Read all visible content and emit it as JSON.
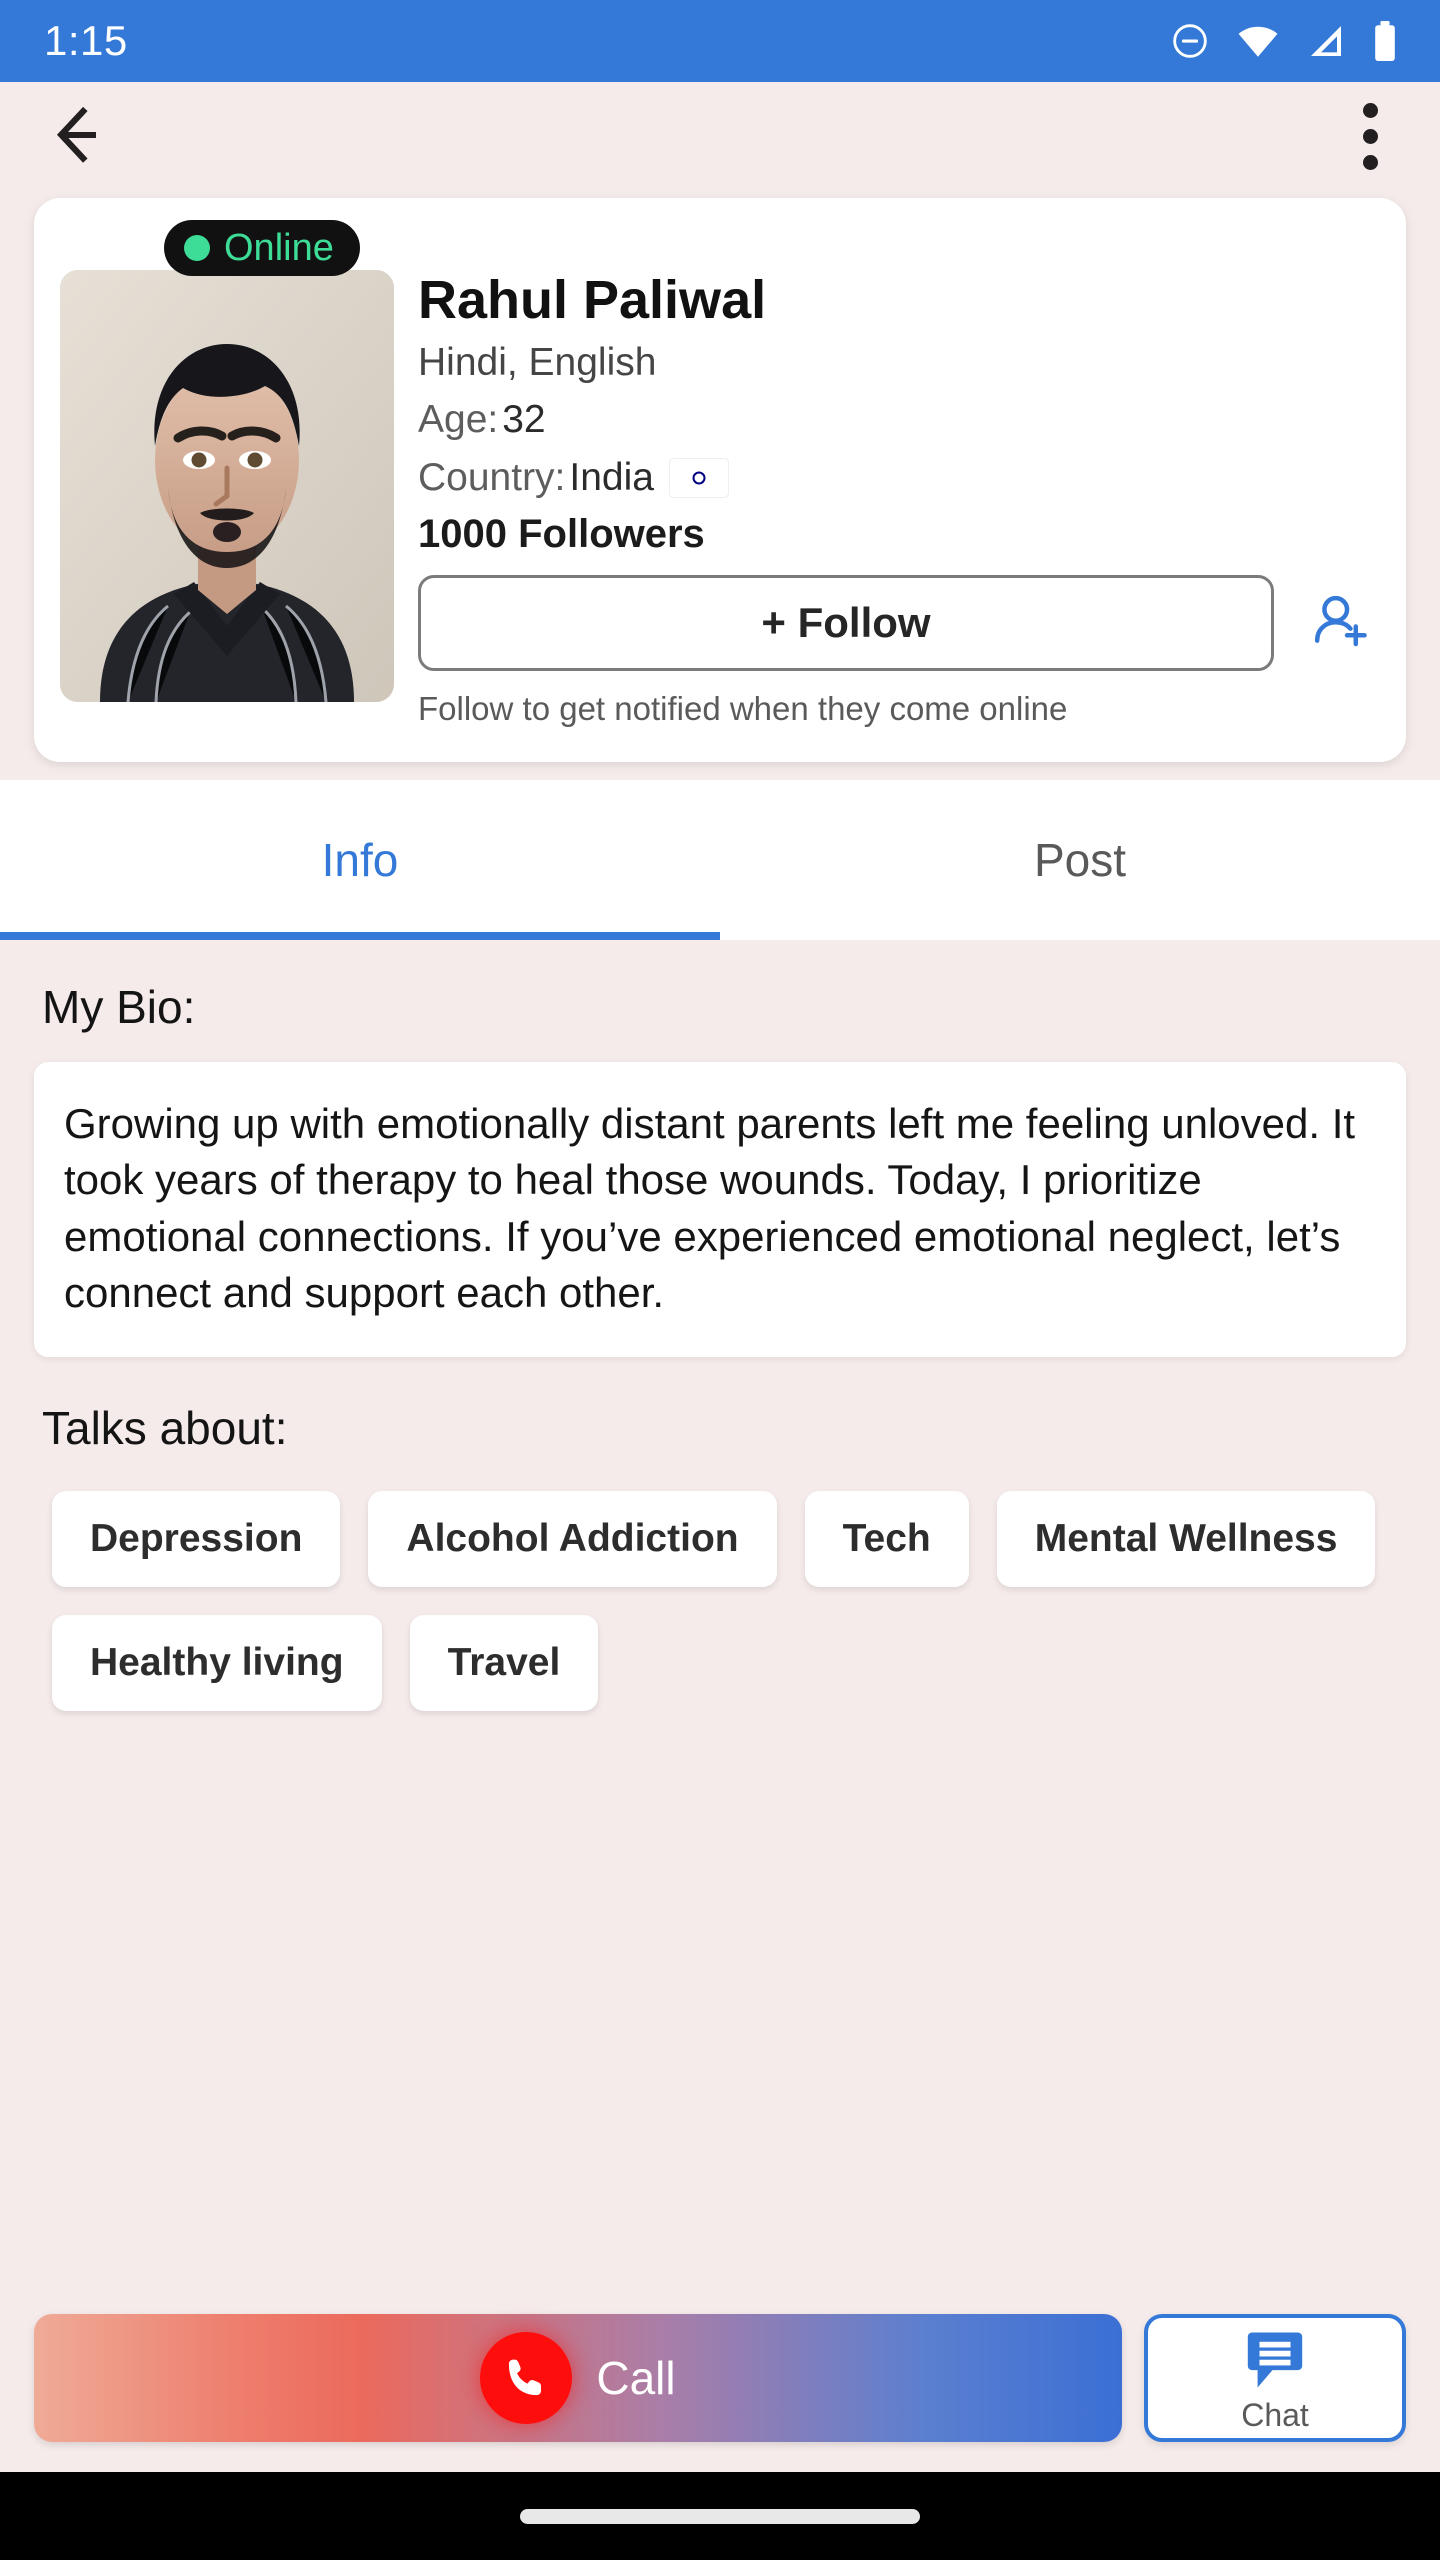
{
  "status_bar": {
    "time": "1:15",
    "background_color": "#3479D8",
    "icons": [
      "do-not-disturb-icon",
      "wifi-icon",
      "cellular-signal-icon",
      "battery-icon"
    ]
  },
  "app_bar": {
    "back_icon": "back-arrow-icon",
    "overflow_icon": "overflow-menu-icon"
  },
  "profile": {
    "status_badge": "Online",
    "status_color": "#3DDC97",
    "name": "Rahul Paliwal",
    "languages": "Hindi, English",
    "age_label": "Age:",
    "age_value": "32",
    "country_label": "Country:",
    "country_value": "India",
    "country_flag": "india-flag-icon",
    "followers": "1000 Followers",
    "follow_button": "+ Follow",
    "follow_icon": "person-add-icon",
    "follow_hint": "Follow to get notified when they come online",
    "avatar": "profile-photo"
  },
  "tabs": [
    {
      "label": "Info",
      "active": true
    },
    {
      "label": "Post",
      "active": false
    }
  ],
  "bio": {
    "heading": "My Bio:",
    "text": "Growing up with emotionally distant parents left me feeling unloved. It took years of therapy to heal those wounds. Today, I prioritize emotional connections. If you’ve experienced emotional neglect, let’s connect and support each other."
  },
  "talks_about": {
    "heading": "Talks about:",
    "tags": [
      "Depression",
      "Alcohol Addiction",
      "Tech",
      "Mental Wellness",
      "Healthy living",
      "Travel"
    ]
  },
  "actions": {
    "call_label": "Call",
    "call_icon": "phone-icon",
    "call_icon_color": "#FE0D0D",
    "chat_label": "Chat",
    "chat_icon": "chat-bubble-icon",
    "chat_accent_color": "#3479D8"
  },
  "nav_bar": {
    "home_indicator": "home-indicator-pill"
  },
  "theme": {
    "page_background": "#F5EBEB",
    "accent": "#3479D8",
    "card_background": "#FFFFFF"
  }
}
